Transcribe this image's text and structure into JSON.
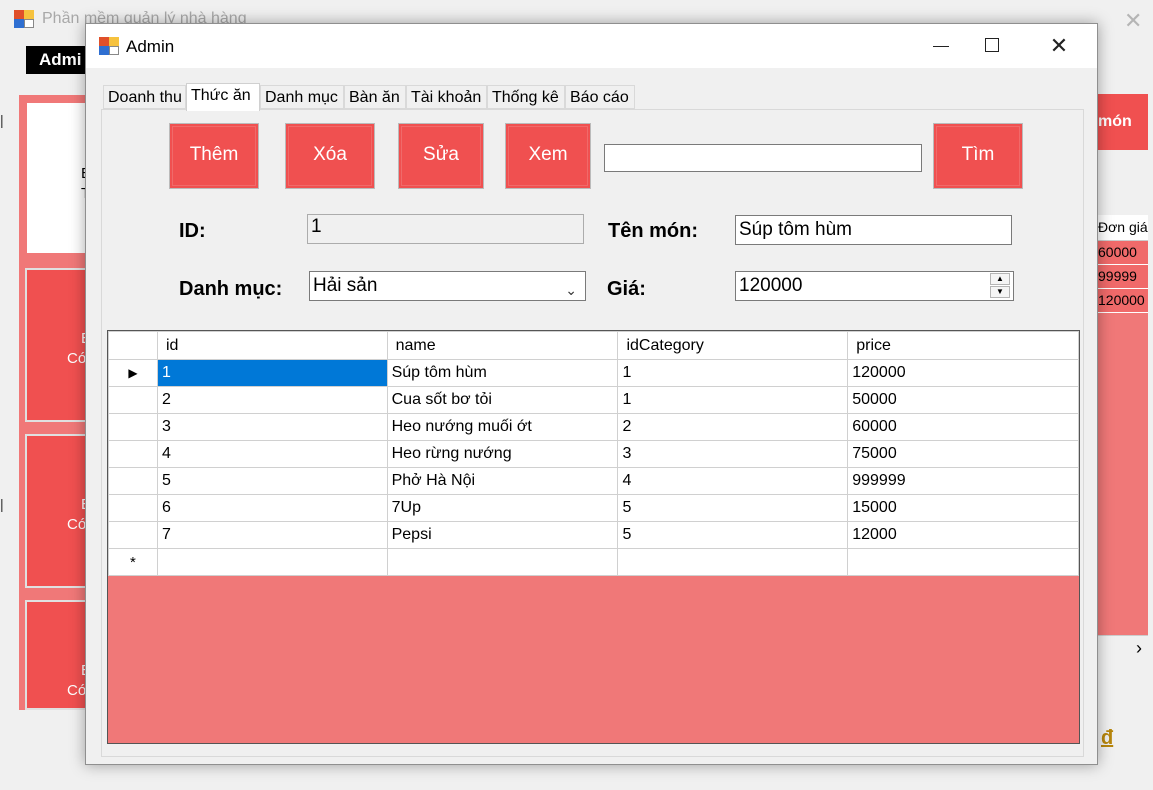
{
  "background_window": {
    "title": "Phần mềm quản lý nhà hàng",
    "menu_label": "Admi",
    "tiles": [
      {
        "line1": "B",
        "line2": "T"
      },
      {
        "line1": "B",
        "line2": "Có"
      },
      {
        "line1": "B",
        "line2": "Có"
      },
      {
        "line1": "B",
        "line2": "Có"
      }
    ],
    "right_button": "món",
    "right_grid_header": "Đơn giá",
    "right_grid_values": [
      "60000",
      "99999",
      "120000"
    ],
    "total_symbol": "đ"
  },
  "dialog": {
    "title": "Admin",
    "tabs": [
      "Doanh thu",
      "Thức ăn",
      "Danh mục",
      "Bàn ăn",
      "Tài khoản",
      "Thống kê",
      "Báo cáo"
    ],
    "active_tab": "Thức ăn",
    "buttons": {
      "add": "Thêm",
      "delete": "Xóa",
      "edit": "Sửa",
      "view": "Xem",
      "search": "Tìm"
    },
    "search_value": "",
    "form": {
      "id_label": "ID:",
      "id_value": "1",
      "name_label": "Tên món:",
      "name_value": "Súp tôm hùm",
      "category_label": "Danh mục:",
      "category_value": "Hải sản",
      "price_label": "Giá:",
      "price_value": "120000"
    },
    "grid": {
      "columns": [
        "id",
        "name",
        "idCategory",
        "price"
      ],
      "rows": [
        {
          "id": "1",
          "name": "Súp tôm hùm",
          "idCategory": "1",
          "price": "120000"
        },
        {
          "id": "2",
          "name": "Cua sốt bơ tỏi",
          "idCategory": "1",
          "price": "50000"
        },
        {
          "id": "3",
          "name": "Heo nướng muối ớt",
          "idCategory": "2",
          "price": "60000"
        },
        {
          "id": "4",
          "name": "Heo rừng nướng",
          "idCategory": "3",
          "price": "75000"
        },
        {
          "id": "5",
          "name": "Phở Hà Nội",
          "idCategory": "4",
          "price": "999999"
        },
        {
          "id": "6",
          "name": "7Up",
          "idCategory": "5",
          "price": "15000"
        },
        {
          "id": "7",
          "name": "Pepsi",
          "idCategory": "5",
          "price": "12000"
        }
      ],
      "current_row_marker": "▶",
      "new_row_marker": "*"
    }
  },
  "colors": {
    "button_red": "#f05050",
    "grid_background": "#f07878",
    "selection_blue": "#0078d7"
  }
}
